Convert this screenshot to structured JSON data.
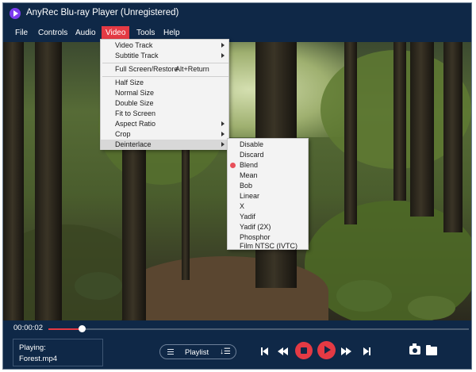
{
  "app": {
    "title": "AnyRec Blu-ray Player (Unregistered)",
    "logo_icon": "anyrec-play-logo-icon"
  },
  "menubar": {
    "items": [
      "File",
      "Controls",
      "Audio",
      "Video",
      "Tools",
      "Help"
    ],
    "active": "Video"
  },
  "video_menu": {
    "items": [
      {
        "label": "Video Track",
        "submenu": true
      },
      {
        "label": "Subtitle Track",
        "submenu": true
      },
      {
        "label": "Full Screen/Restore",
        "shortcut": "Alt+Return"
      },
      {
        "label": "Half Size"
      },
      {
        "label": "Normal Size"
      },
      {
        "label": "Double Size"
      },
      {
        "label": "Fit to Screen"
      },
      {
        "label": "Aspect Ratio",
        "submenu": true
      },
      {
        "label": "Crop",
        "submenu": true
      },
      {
        "label": "Deinterlace",
        "submenu": true,
        "highlighted": true
      }
    ]
  },
  "deinterlace_menu": {
    "items": [
      "Disable",
      "Discard",
      "Blend",
      "Mean",
      "Bob",
      "Linear",
      "X",
      "Yadif",
      "Yadif (2X)",
      "Phosphor",
      "Film NTSC (IVTC)"
    ],
    "selected": "Blend"
  },
  "playback": {
    "current_time": "00:00:02",
    "progress": 0.08,
    "now_playing_label": "Playing:",
    "now_playing_file": "Forest.mp4"
  },
  "controls": {
    "playlist_label": "Playlist",
    "sort_glyph": "↓☰"
  },
  "colors": {
    "background": "#0f2847",
    "accent": "#e43a44"
  }
}
